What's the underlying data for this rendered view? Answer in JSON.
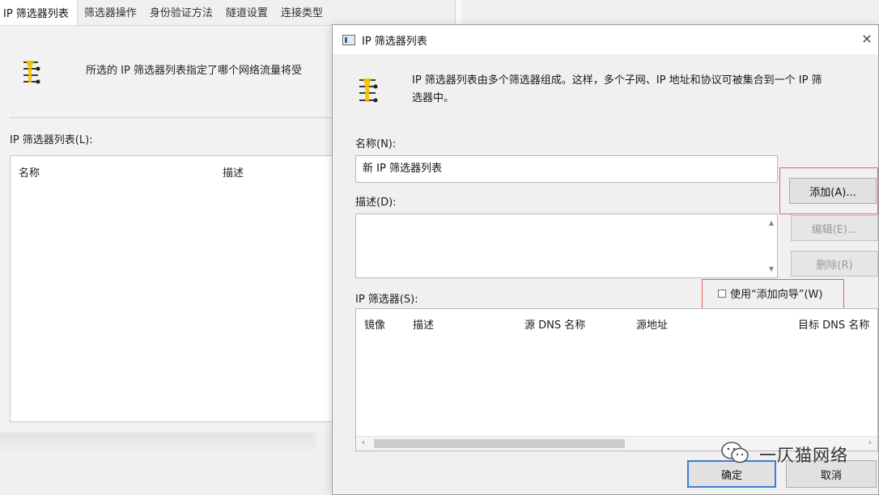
{
  "background_window": {
    "tabs": [
      "IP 筛选器列表",
      "筛选器操作",
      "身份验证方法",
      "隧道设置",
      "连接类型"
    ],
    "active_tab": 0,
    "description": "所选的 IP 筛选器列表指定了哪个网络流量将受",
    "list_label": "IP 筛选器列表(L):",
    "columns": [
      "名称",
      "描述"
    ]
  },
  "dialog": {
    "title": "IP 筛选器列表",
    "close_label": "×",
    "intro_line1": "IP 筛选器列表由多个筛选器组成。这样，多个子网、IP 地址和协议可被集合到一个 IP 筛",
    "intro_line2": "选器中。",
    "name_label": "名称(N):",
    "name_value": "新 IP 筛选器列表",
    "description_label": "描述(D):",
    "description_value": "",
    "add_button": "添加(A)...",
    "edit_button": "编辑(E)...",
    "delete_button": "删除(R)",
    "filters_label": "IP 筛选器(S):",
    "wizard_checkbox_label": "使用“添加向导”(W)",
    "wizard_checked": false,
    "filter_columns": [
      "镜像",
      "描述",
      "源 DNS 名称",
      "源地址",
      "目标 DNS 名称"
    ],
    "ok_button": "确定",
    "cancel_button": "取消"
  },
  "watermark": {
    "text": "一仄猫网络",
    "icon": "wechat-icon"
  },
  "colors": {
    "highlight": "#e2655d",
    "primary_border": "#3c7fd1",
    "filter_icon_yellow": "#f2c200"
  }
}
